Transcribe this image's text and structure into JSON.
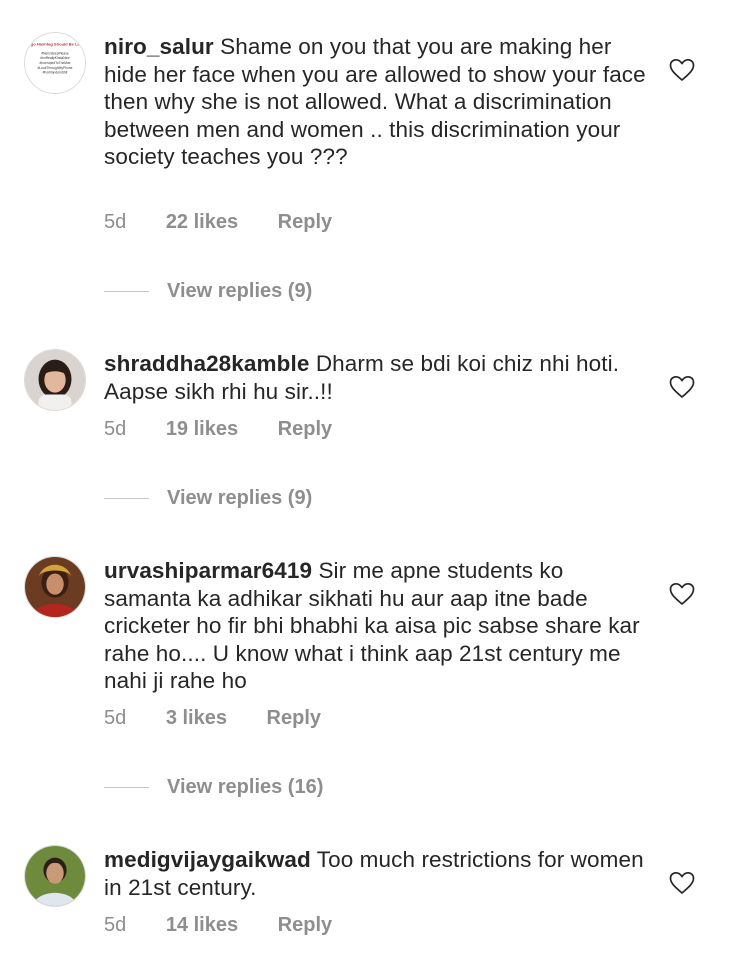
{
  "comments": [
    {
      "username": "niro_salur",
      "text": "Shame on you that you are making her hide her face when you are allowed to show your face then why she is not allowed. What a discrimination between men and women .. this discrimination your society teaches you ???",
      "time": "5d",
      "likes": "22 likes",
      "reply": "Reply",
      "view_replies": "View replies (9)",
      "avatar_text": {
        "title": "Virgo Hashtag Should Be Like:",
        "lines": [
          "#NeroSleepPlease",
          "#ImReallyKindaNice",
          "#IcorrupedToTheMax",
          "#LookThroughMyPhone",
          "#ForRandomShit"
        ]
      }
    },
    {
      "username": "shraddha28kamble",
      "text": "Dharm se bdi koi chiz nhi hoti. Aapse sikh rhi hu sir..!!",
      "time": "5d",
      "likes": "19 likes",
      "reply": "Reply",
      "view_replies": "View replies (9)"
    },
    {
      "username": "urvashiparmar6419",
      "text": "Sir me apne students ko samanta ka adhikar sikhati hu aur aap itne bade cricketer ho fir bhi bhabhi ka aisa pic sabse share kar rahe ho.... U know what i think aap 21st century me nahi ji rahe ho",
      "time": "5d",
      "likes": "3 likes",
      "reply": "Reply",
      "view_replies": "View replies (16)"
    },
    {
      "username": "medigvijaygaikwad",
      "text": "Too much restrictions for women in 21st century.",
      "time": "5d",
      "likes": "14 likes",
      "reply": "Reply"
    }
  ],
  "icons": {
    "like": "heart-outline-icon"
  },
  "colors": {
    "text": "#262626",
    "secondary": "#8e8e8e",
    "divider": "#c7c7c7",
    "heart_stroke": "#262626"
  }
}
